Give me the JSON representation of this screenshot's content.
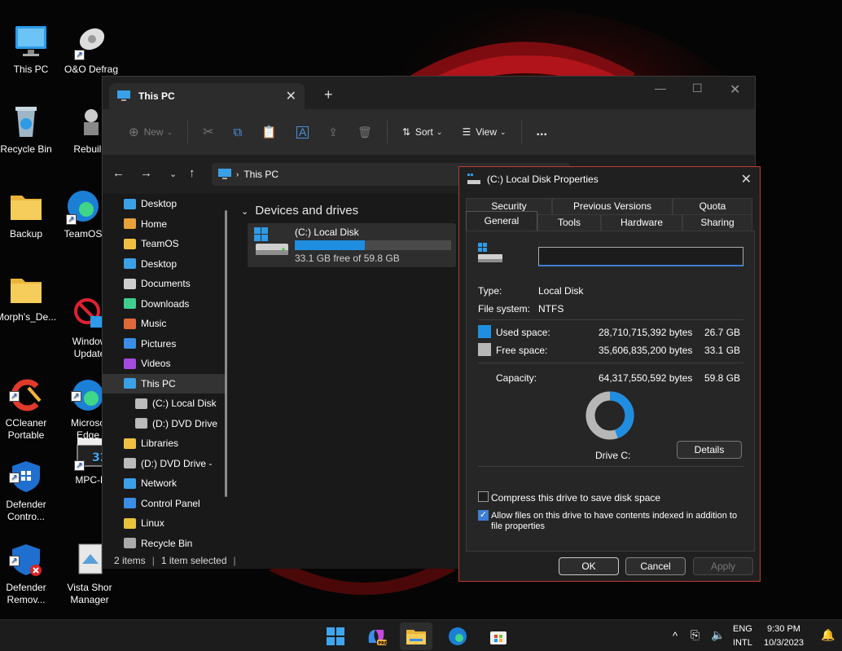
{
  "desktop": {
    "icons": [
      {
        "label": "This PC"
      },
      {
        "label": "O&O Defrag"
      },
      {
        "label": "Recycle Bin"
      },
      {
        "label": "Rebuildi"
      },
      {
        "label": "Backup"
      },
      {
        "label": "TeamOS"
      },
      {
        "label": "Morph's_De..."
      },
      {
        "label": "Window\nUpdate"
      },
      {
        "label": "CCleaner\nPortable"
      },
      {
        "label": "Microso\nEdge"
      },
      {
        "label": "Defender\nContro..."
      },
      {
        "label": "MPC-H"
      },
      {
        "label": "Defender\nRemov..."
      },
      {
        "label": "Vista Shor\nManager"
      }
    ]
  },
  "explorer": {
    "tab_title": "This PC",
    "toolbar": {
      "new": "New",
      "sort": "Sort",
      "view": "View",
      "more": "..."
    },
    "breadcrumb": "This PC",
    "nav": [
      {
        "label": "Desktop",
        "icon": "desktop-icon",
        "color": "#3aa0e8"
      },
      {
        "label": "Home",
        "icon": "home-icon",
        "color": "#e8a23a"
      },
      {
        "label": "TeamOS",
        "icon": "folder-icon",
        "color": "#f0c040"
      },
      {
        "label": "Desktop",
        "icon": "desktop-icon",
        "color": "#3aa0e8"
      },
      {
        "label": "Documents",
        "icon": "document-icon",
        "color": "#cfcfcf"
      },
      {
        "label": "Downloads",
        "icon": "download-icon",
        "color": "#3ecf8e"
      },
      {
        "label": "Music",
        "icon": "music-icon",
        "color": "#e2683a"
      },
      {
        "label": "Pictures",
        "icon": "pictures-icon",
        "color": "#3a8ee8"
      },
      {
        "label": "Videos",
        "icon": "videos-icon",
        "color": "#a44ae0"
      },
      {
        "label": "This PC",
        "icon": "this-pc-icon",
        "color": "#3aa0e8"
      },
      {
        "label": "(C:) Local Disk",
        "icon": "drive-icon",
        "color": "#bbbbbb"
      },
      {
        "label": "(D:) DVD Drive",
        "icon": "dvd-icon",
        "color": "#bbbbbb"
      },
      {
        "label": "Libraries",
        "icon": "folder-icon",
        "color": "#f0c040"
      },
      {
        "label": "(D:) DVD Drive -",
        "icon": "dvd-icon",
        "color": "#bbbbbb"
      },
      {
        "label": "Network",
        "icon": "network-icon",
        "color": "#3aa0e8"
      },
      {
        "label": "Control Panel",
        "icon": "control-panel-icon",
        "color": "#3a8ee8"
      },
      {
        "label": "Linux",
        "icon": "linux-icon",
        "color": "#e8c23a"
      },
      {
        "label": "Recycle Bin",
        "icon": "recycle-bin-icon",
        "color": "#aaaaaa"
      }
    ],
    "section": "Devices and drives",
    "drive": {
      "label": "(C:) Local Disk",
      "free_text": "33.1 GB free of 59.8 GB",
      "used_fraction": 0.446
    },
    "status": {
      "items": "2 items",
      "selected": "1 item selected"
    }
  },
  "dialog": {
    "title": "(C:) Local Disk Properties",
    "tabs_top": [
      "Security",
      "Previous Versions",
      "Quota"
    ],
    "tabs_bottom": [
      "General",
      "Tools",
      "Hardware",
      "Sharing"
    ],
    "name_value": "",
    "type_label": "Type:",
    "type_value": "Local Disk",
    "fs_label": "File system:",
    "fs_value": "NTFS",
    "used_label": "Used space:",
    "used_bytes": "28,710,715,392 bytes",
    "used_gb": "26.7 GB",
    "free_label": "Free space:",
    "free_bytes": "35,606,835,200 bytes",
    "free_gb": "33.1 GB",
    "cap_label": "Capacity:",
    "cap_bytes": "64,317,550,592 bytes",
    "cap_gb": "59.8 GB",
    "drive_caption": "Drive C:",
    "details": "Details",
    "compress": "Compress this drive to save disk space",
    "index_line1": "Allow files on this drive to have contents indexed in addition to",
    "index_line2": "file properties",
    "ok": "OK",
    "cancel": "Cancel",
    "apply": "Apply",
    "used_color": "#1f8ee0",
    "free_color": "#b7b7b7"
  },
  "taskbar": {
    "lang": "ENG",
    "layout": "INTL",
    "time": "9:30 PM",
    "date": "10/3/2023"
  }
}
